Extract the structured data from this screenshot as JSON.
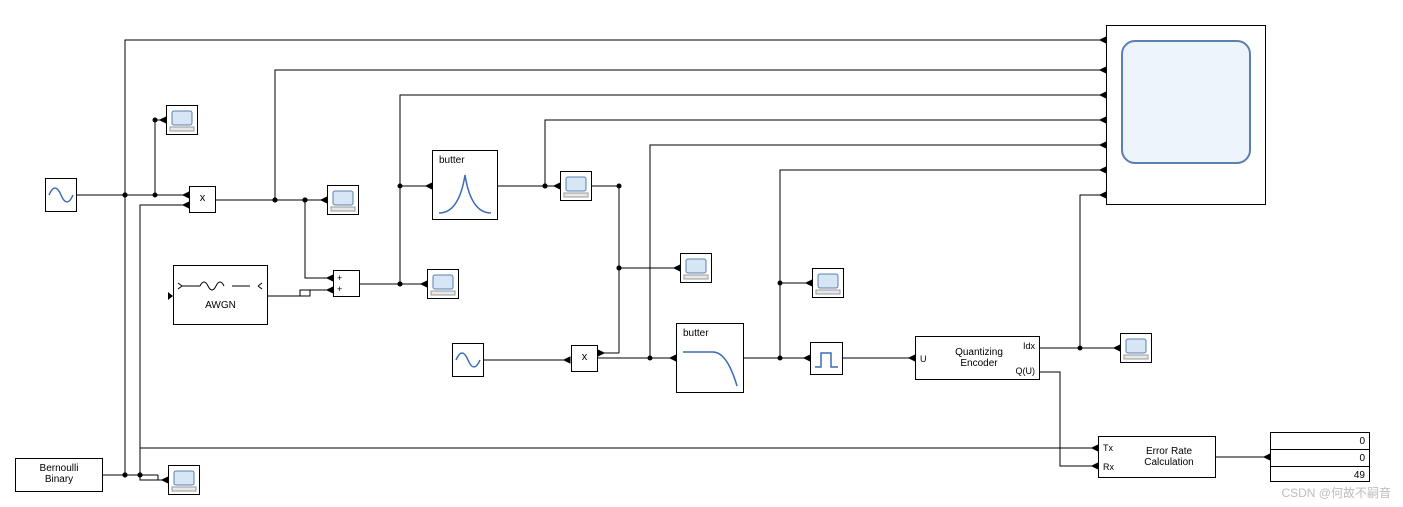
{
  "blocks": {
    "bernoulli": "Bernoulli\nBinary",
    "awgn": "AWGN",
    "product1": "x",
    "product2": "x",
    "sum": {
      "s1": "+",
      "s2": "+"
    },
    "butter1": "butter",
    "butter2": "butter",
    "quant": {
      "name": "Quantizing\nEncoder",
      "inport": "U",
      "out1": "Idx",
      "out2": "Q(U)"
    },
    "erc": {
      "name": "Error Rate\nCalculation",
      "in1": "Tx",
      "in2": "Rx"
    },
    "display": {
      "v1": "0",
      "v2": "0",
      "v3": "49"
    }
  },
  "watermark": "CSDN @何故不嗣音"
}
